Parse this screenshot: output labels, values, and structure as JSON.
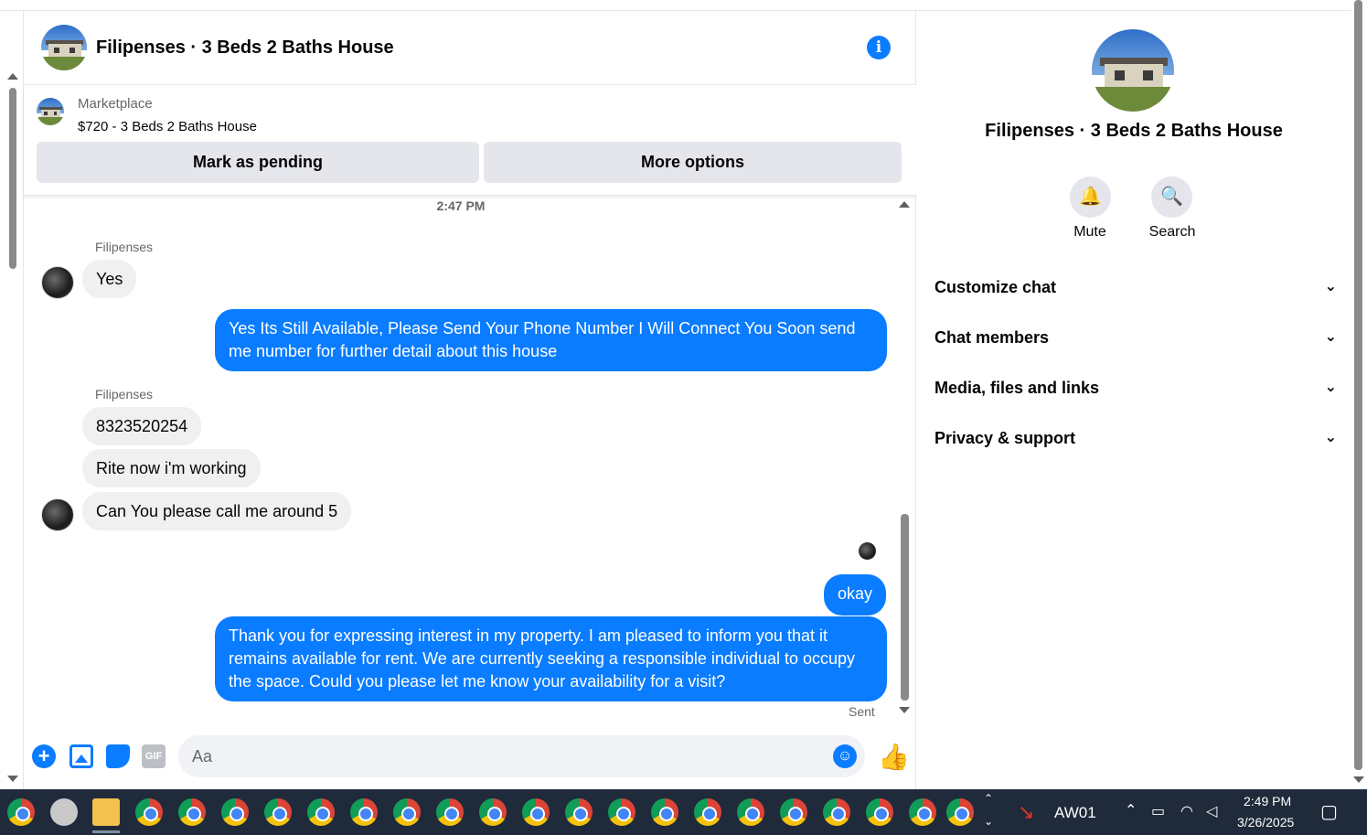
{
  "conversation": {
    "title": "Filipenses · 3 Beds 2 Baths House"
  },
  "marketplace": {
    "label": "Marketplace",
    "item": "$720 - 3 Beds 2 Baths House",
    "buttons": [
      "Mark as pending",
      "More options"
    ]
  },
  "messages": {
    "timestamp": "2:47 PM",
    "sender_name": "Filipenses",
    "items": [
      {
        "from": "them",
        "text": "Yes"
      },
      {
        "from": "me",
        "text": "Yes Its Still Available, Please Send Your Phone Number I Will Connect You Soon send me number for further detail about this house"
      },
      {
        "from": "them",
        "text": "8323520254"
      },
      {
        "from": "them",
        "text": "Rite now i'm working"
      },
      {
        "from": "them",
        "text": "Can You please call me around 5"
      },
      {
        "from": "me",
        "text": "okay"
      },
      {
        "from": "me",
        "text": "Thank you for expressing interest in my property. I am pleased to inform you that it remains available for rent. We are currently seeking a responsible individual to occupy the space. Could you please let me know your availability for a visit?"
      }
    ],
    "status": "Sent"
  },
  "composer": {
    "placeholder": "Aa",
    "gif_label": "GIF"
  },
  "info_panel": {
    "title": "Filipenses · 3 Beds 2 Baths House",
    "actions": [
      "Mute",
      "Search"
    ],
    "sections": [
      "Customize chat",
      "Chat members",
      "Media, files and links",
      "Privacy & support"
    ]
  },
  "taskbar": {
    "app_label": "AW01",
    "time": "2:49 PM",
    "date": "3/26/2025"
  },
  "colors": {
    "accent": "#0a7cff",
    "bubble_in": "#f0f0f0",
    "button_bg": "#e4e6eb",
    "taskbar": "#1f2b3a"
  }
}
